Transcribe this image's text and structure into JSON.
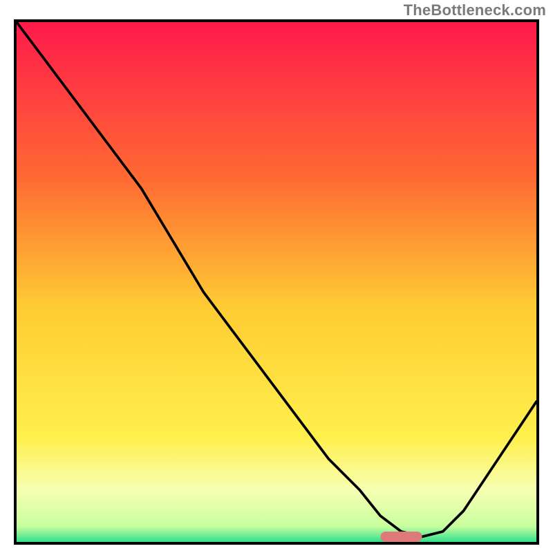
{
  "watermark": "TheBottleneck.com",
  "chart_data": {
    "type": "line",
    "title": "",
    "xlabel": "",
    "ylabel": "",
    "xlim": [
      0,
      100
    ],
    "ylim": [
      0,
      100
    ],
    "series": [
      {
        "name": "bottleneck-curve",
        "x": [
          0,
          6,
          12,
          18,
          24,
          30,
          36,
          42,
          48,
          54,
          60,
          66,
          70,
          74,
          78,
          82,
          86,
          90,
          94,
          100
        ],
        "y": [
          100,
          92,
          84,
          76,
          68,
          58,
          48,
          40,
          32,
          24,
          16,
          10,
          5,
          2,
          1,
          2,
          6,
          12,
          18,
          27
        ]
      }
    ],
    "marker": {
      "x": 74,
      "y": 1,
      "width": 8,
      "height": 2,
      "color": "#e07a7a"
    },
    "gradient_stops": [
      {
        "offset": 0.0,
        "color": "#ff1a4b"
      },
      {
        "offset": 0.3,
        "color": "#ff6a33"
      },
      {
        "offset": 0.55,
        "color": "#ffcc33"
      },
      {
        "offset": 0.8,
        "color": "#fff04d"
      },
      {
        "offset": 0.9,
        "color": "#f7ffb3"
      },
      {
        "offset": 0.97,
        "color": "#c8ff9e"
      },
      {
        "offset": 1.0,
        "color": "#2fe08c"
      }
    ]
  }
}
